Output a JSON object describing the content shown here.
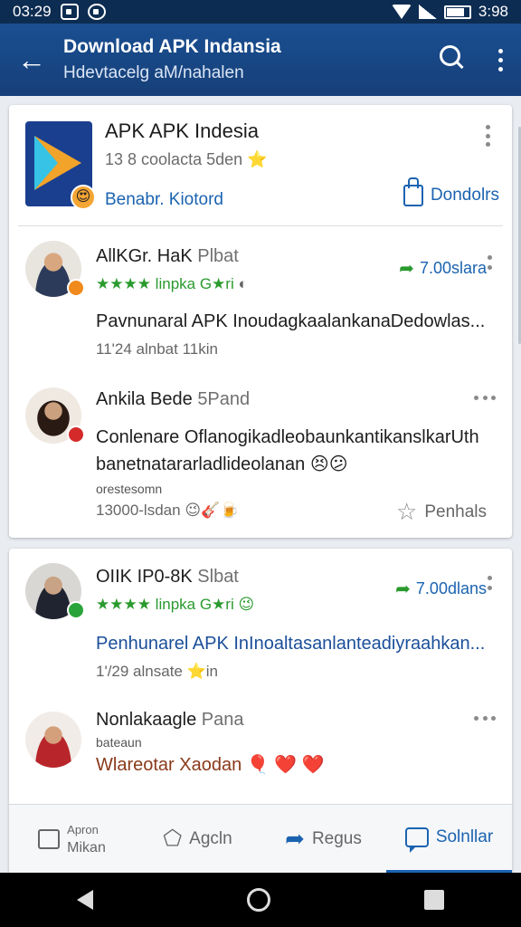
{
  "status": {
    "time": "03:29",
    "battery": "3:98"
  },
  "appbar": {
    "title": "Download APK Indansia",
    "subtitle": "Hdevtacelg aM/nahalen"
  },
  "app": {
    "name": "APK APK Indesia",
    "meta": "13 8 coolacta 5den",
    "meta_star": "⭐",
    "link": "Benabr. Kiotord",
    "download_label": "Dondolrs"
  },
  "posts": [
    {
      "name": "AllKGr. HaK",
      "name_tag": "Plbat",
      "rating": "★★★★ linpka G★ri",
      "shares": "7.00slara",
      "text": "Pavnunaral APK InoudagkaalankanaDedowlas...",
      "meta": "11'24 alnbat 11kin"
    },
    {
      "name": "Ankila Bede",
      "name_tag": "5Pand",
      "text_line1": "Conlenare OflanogikadleobaunkantikanslkarUth",
      "text_line2": "banetnatararladlideolanan 😣😕",
      "sub": "orestesomn",
      "meta": "13000-lsdan",
      "meta_emoji": "😉🎸🍺",
      "like_label": "Penhals"
    },
    {
      "name": "OIIK IP0-8K",
      "name_tag": "Slbat",
      "rating": "★★★★ linpka G★ri",
      "rating_emoji": "😉",
      "shares": "7.00dlans",
      "text": "Penhunarel APK InInoaltasanlanteadiyraahkan...",
      "meta": "1'/29 alnsate",
      "meta_emoji": "⭐in"
    },
    {
      "name": "Nonlakaagle",
      "name_tag": "Pana",
      "sub": "bateaun",
      "text": "Wlareotar Xaodan",
      "text_emoji": "🎈 ❤️ ❤️"
    }
  ],
  "actions": [
    {
      "top": "Apron",
      "label": "Mikan"
    },
    {
      "label": "Agcln"
    },
    {
      "label": "Regus"
    },
    {
      "label": "Solnllar"
    }
  ],
  "colors": {
    "appbar": "#1a4a8a",
    "link": "#1b63b0",
    "rating": "#2a9a2e"
  }
}
